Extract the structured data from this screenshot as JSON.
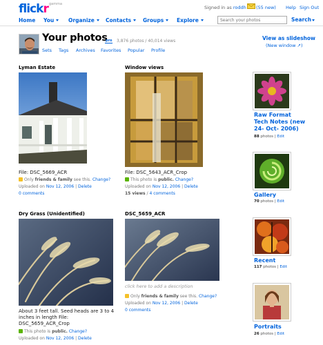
{
  "header": {
    "logo": {
      "flick": "flick",
      "r": "r",
      "beta": "gamma"
    },
    "signed_in_prefix": "Signed in as",
    "username": "roddh",
    "new_count": "(55 new)",
    "help": "Help",
    "sign_out": "Sign Out"
  },
  "nav": {
    "home": "Home",
    "you": "You",
    "organize": "Organize",
    "contacts": "Contacts",
    "groups": "Groups",
    "explore": "Explore",
    "search_placeholder": "Search your photos",
    "search_button": "Search"
  },
  "profile": {
    "title": "Your photos",
    "pro_badge": "pro",
    "stats": "3,876 photos / 40,014 views",
    "links": [
      "Sets",
      "Tags",
      "Archives",
      "Favorites",
      "Popular",
      "Profile"
    ],
    "slideshow": "View as slideshow",
    "new_window": "(New window ↗)"
  },
  "photos": [
    {
      "title": "Lyman Estate",
      "file": "File: DSC_5669_ACR",
      "privacy_pre": "Only",
      "privacy_strong": "friends & family",
      "privacy_post": "see this.",
      "change": "Change?",
      "uploaded_prefix": "Uploaded on",
      "date": "Nov 12, 2006",
      "sep": "|",
      "delete": "Delete",
      "comments": "0 comments"
    },
    {
      "title": "Window views",
      "file": "File: DSC_5643_ACR_Crop",
      "privacy_pre": "This photo is",
      "privacy_strong": "public.",
      "privacy_post": "",
      "change": "Change?",
      "uploaded_prefix": "Uploaded on",
      "date": "Nov 12, 2006",
      "sep": "|",
      "delete": "Delete",
      "views_count": "15 views",
      "views_sep": "/",
      "comments": "4 comments"
    },
    {
      "title": "Dry Grass (Unidentified)",
      "desc_line1": "About 3 feet tall. Seed heads are 3 to 4",
      "desc_line2": "inches in length File:",
      "desc_line3": "DSC_5659_ACR_Crop",
      "privacy_pre": "This photo is",
      "privacy_strong": "public.",
      "privacy_post": "",
      "change": "Change?",
      "uploaded_prefix": "Uploaded on",
      "date": "Nov 12, 2006",
      "sep": "|",
      "delete": "Delete"
    },
    {
      "title": "DSC_5659_ACR",
      "add_desc": "click here to add a description",
      "privacy_pre": "Only",
      "privacy_strong": "friends & family",
      "privacy_post": "see this.",
      "change": "Change?",
      "uploaded_prefix": "Uploaded on",
      "date": "Nov 12, 2006",
      "sep": "|",
      "delete": "Delete",
      "comments": "0 comments"
    }
  ],
  "sets": [
    {
      "title_l1": "Raw Format",
      "title_l2": "Tech Notes (new",
      "title_l3": "24- Oct- 2006)",
      "count": "88",
      "unit": "photos",
      "sep": "|",
      "edit": "Edit"
    },
    {
      "title_l1": "Gallery",
      "count": "70",
      "unit": "photos",
      "sep": "|",
      "edit": "Edit"
    },
    {
      "title_l1": "Recent",
      "count": "117",
      "unit": "photos",
      "sep": "|",
      "edit": "Edit"
    },
    {
      "title_l1": "Portraits",
      "count": "26",
      "unit": "photos",
      "sep": "|",
      "edit": "Edit"
    }
  ],
  "colors": {
    "link": "#0063dc",
    "brand_pink": "#ff0084"
  },
  "icons": [
    "mail-icon",
    "privacy-family-icon",
    "privacy-public-icon"
  ]
}
